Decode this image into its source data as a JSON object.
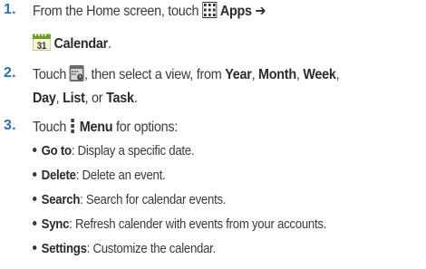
{
  "steps": [
    {
      "number": "1.",
      "lines": [
        {
          "pre": "From the Home screen, touch ",
          "icon": "apps-grid-icon",
          "bold": "Apps",
          "arrow": "➔"
        },
        {
          "icon": "calendar-icon",
          "icon_text": "31",
          "bold": "Calendar",
          "post": "."
        }
      ]
    },
    {
      "number": "2.",
      "lines": [
        {
          "pre": "Touch ",
          "icon": "calendar-view-icon",
          "mid": ", then select a view, from ",
          "b1": "Year",
          "s1": ", ",
          "b2": "Month",
          "s2": ", ",
          "b3": "Week",
          "s3": ","
        },
        {
          "b4": "Day",
          "s4": ", ",
          "b5": "List",
          "s5": ", or ",
          "b6": "Task",
          "s6": "."
        }
      ]
    },
    {
      "number": "3.",
      "lines": [
        {
          "pre": "Touch ",
          "icon": "menu-dots-icon",
          "bold": "Menu",
          "post": " for options:"
        }
      ],
      "bullets": [
        {
          "label": "Go to",
          "text": ": Display a specific date."
        },
        {
          "label": "Delete",
          "text": ": Delete an event."
        },
        {
          "label": "Search",
          "text": ": Search for calendar events."
        },
        {
          "label": "Sync",
          "text": ": Refresh calender with events from your accounts."
        },
        {
          "label": "Settings",
          "text": ": Customize the calendar."
        }
      ]
    }
  ]
}
